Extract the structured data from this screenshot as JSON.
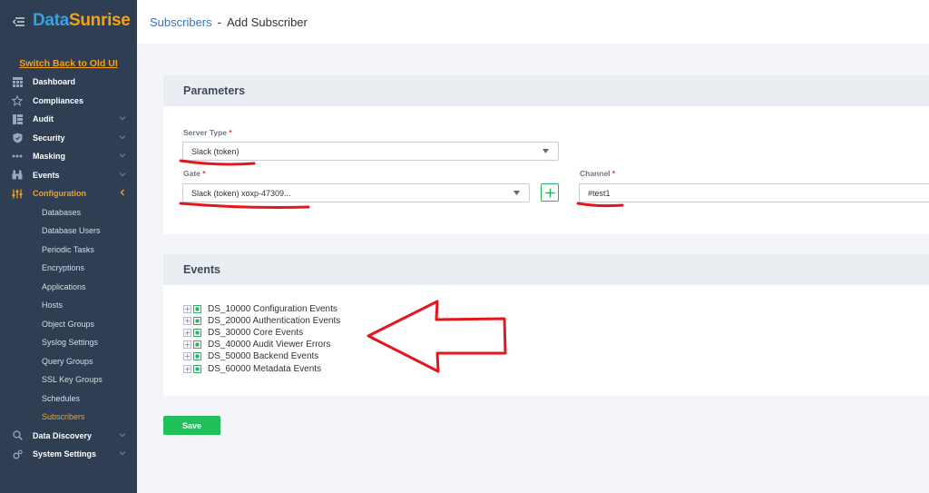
{
  "logo": {
    "part1": "Data",
    "part2": "Sunrise"
  },
  "sidebar": {
    "switch_link": "Switch Back to Old UI",
    "items": [
      {
        "label": "Dashboard",
        "icon": "grid-icon",
        "chevron": false
      },
      {
        "label": "Compliances",
        "icon": "star-icon",
        "chevron": false
      },
      {
        "label": "Audit",
        "icon": "audit-icon",
        "chevron": true
      },
      {
        "label": "Security",
        "icon": "shield-icon",
        "chevron": true
      },
      {
        "label": "Masking",
        "icon": "mask-icon",
        "chevron": true
      },
      {
        "label": "Events",
        "icon": "binoculars-icon",
        "chevron": true
      },
      {
        "label": "Configuration",
        "icon": "sliders-icon",
        "chevron": true,
        "active": true
      }
    ],
    "config_subitems": [
      "Databases",
      "Database Users",
      "Periodic Tasks",
      "Encryptions",
      "Applications",
      "Hosts",
      "Object Groups",
      "Syslog Settings",
      "Query Groups",
      "SSL Key Groups",
      "Schedules",
      "Subscribers"
    ],
    "bottom_items": [
      {
        "label": "Data Discovery",
        "icon": "search-icon"
      },
      {
        "label": "System Settings",
        "icon": "gear-icon"
      }
    ]
  },
  "header": {
    "breadcrumb_link": "Subscribers",
    "separator": "-",
    "page_title": "Add Subscriber"
  },
  "parameters": {
    "title": "Parameters",
    "server_type_label": "Server Type",
    "server_type_value": "Slack (token)",
    "gate_label": "Gate",
    "gate_value": "Slack (token) xoxp-47309...",
    "channel_label": "Channel",
    "channel_value": "#test1",
    "required_mark": "*"
  },
  "events": {
    "title": "Events",
    "items": [
      "DS_10000 Configuration Events",
      "DS_20000 Authentication Events",
      "DS_30000 Core Events",
      "DS_40000 Audit Viewer Errors",
      "DS_50000 Backend Events",
      "DS_60000 Metadata Events"
    ]
  },
  "save_label": "Save",
  "colors": {
    "sidebar": "#2f3e52",
    "accent": "#f2a21b",
    "brand_blue": "#3aa0e0",
    "green": "#22c05a",
    "annotation_red": "#e3161d"
  }
}
